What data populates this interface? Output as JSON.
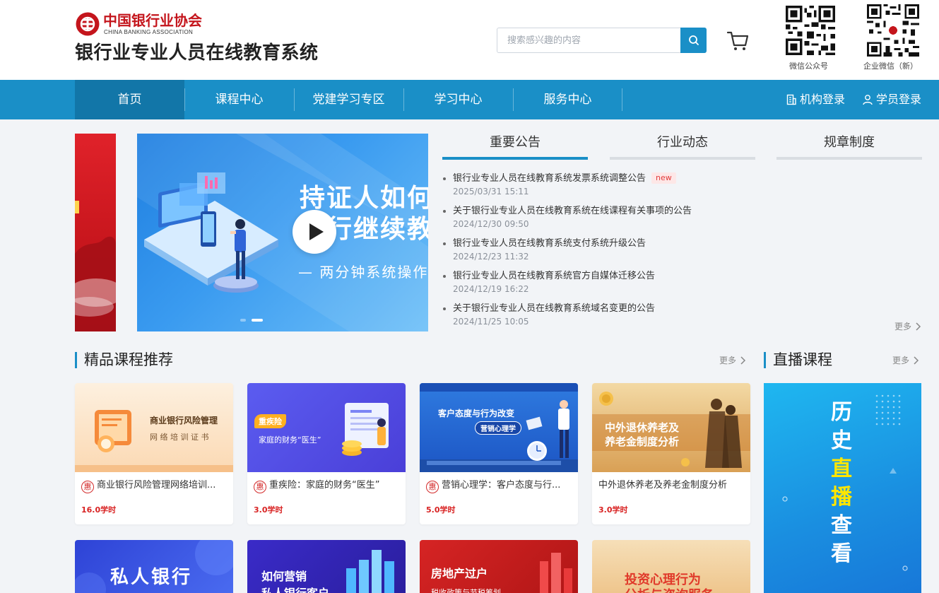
{
  "header": {
    "org_name": "中国银行业协会",
    "org_name_en": "CHINA BANKING  ASSOCIATION",
    "system_title": "银行业专业人员在线教育系统",
    "search_placeholder": "搜索感兴趣的内容",
    "qr_codes": [
      {
        "label": "微信公众号"
      },
      {
        "label": "企业微信（新）"
      }
    ]
  },
  "nav": {
    "items": [
      {
        "label": "首页",
        "active": true
      },
      {
        "label": "课程中心",
        "active": false
      },
      {
        "label": "党建学习专区",
        "active": false
      },
      {
        "label": "学习中心",
        "active": false
      },
      {
        "label": "服务中心",
        "active": false
      }
    ],
    "org_login": "机构登录",
    "student_login": "学员登录"
  },
  "banner": {
    "line1": "持证人如何",
    "line2": "进行继续教",
    "line3": "— 两分钟系统操作介",
    "active_slide": 1,
    "slide_count": 2
  },
  "notices": {
    "tabs": [
      "重要公告",
      "行业动态",
      "规章制度"
    ],
    "active_tab": 0,
    "items": [
      {
        "title": "银行业专业人员在线教育系统发票系统调整公告",
        "date": "2025/03/31 15:11",
        "badge": "new"
      },
      {
        "title": "关于银行业专业人员在线教育系统在线课程有关事项的公告",
        "date": "2024/12/30 09:50"
      },
      {
        "title": "银行业专业人员在线教育系统支付系统升级公告",
        "date": "2024/12/23 11:32"
      },
      {
        "title": "银行业专业人员在线教育系统官方自媒体迁移公告",
        "date": "2024/12/19 16:22"
      },
      {
        "title": "关于银行业专业人员在线教育系统域名变更的公告",
        "date": "2024/11/25 10:05"
      }
    ],
    "more": "更多"
  },
  "courses": {
    "section_title": "精品课程推荐",
    "more": "更多",
    "hui_label": "惠",
    "items": [
      {
        "name": "商业银行风险管理网络培训...",
        "hours": "16.0学时",
        "discount": true,
        "img_line1": "商业银行风险管理",
        "img_line2": "网 络 培 训 证 书"
      },
      {
        "name": "重疾险：家庭的财务“医生”",
        "hours": "3.0学时",
        "discount": true,
        "img_tag": "重疾险",
        "img_line1": "家庭的财务“医生”"
      },
      {
        "name": "营销心理学：客户态度与行...",
        "hours": "5.0学时",
        "discount": true,
        "img_line1": "客户态度与行为改变",
        "img_tag": "营销心理学"
      },
      {
        "name": "中外退休养老及养老金制度分析",
        "hours": "3.0学时",
        "discount": false,
        "img_line1": "中外退休养老及",
        "img_line2": "养老金制度分析"
      }
    ],
    "row2": [
      {
        "img_line1": "私人银行"
      },
      {
        "img_line1": "如何营销",
        "img_line2": "私人银行客户"
      },
      {
        "img_line1": "房地产过户",
        "img_line2": "税收政策与节税筹划"
      },
      {
        "img_line1": "投资心理行为",
        "img_line2": "分析与咨询服务"
      }
    ]
  },
  "live": {
    "section_title": "直播课程",
    "more": "更多",
    "banner_chars": [
      "历",
      "史",
      "直",
      "播",
      "查",
      "看"
    ]
  },
  "colors": {
    "primary": "#1a8fc7",
    "nav_active": "#1276a8",
    "brand_red": "#c4151c",
    "hours_red": "#d82222",
    "highlight_yellow": "#ffe600"
  }
}
